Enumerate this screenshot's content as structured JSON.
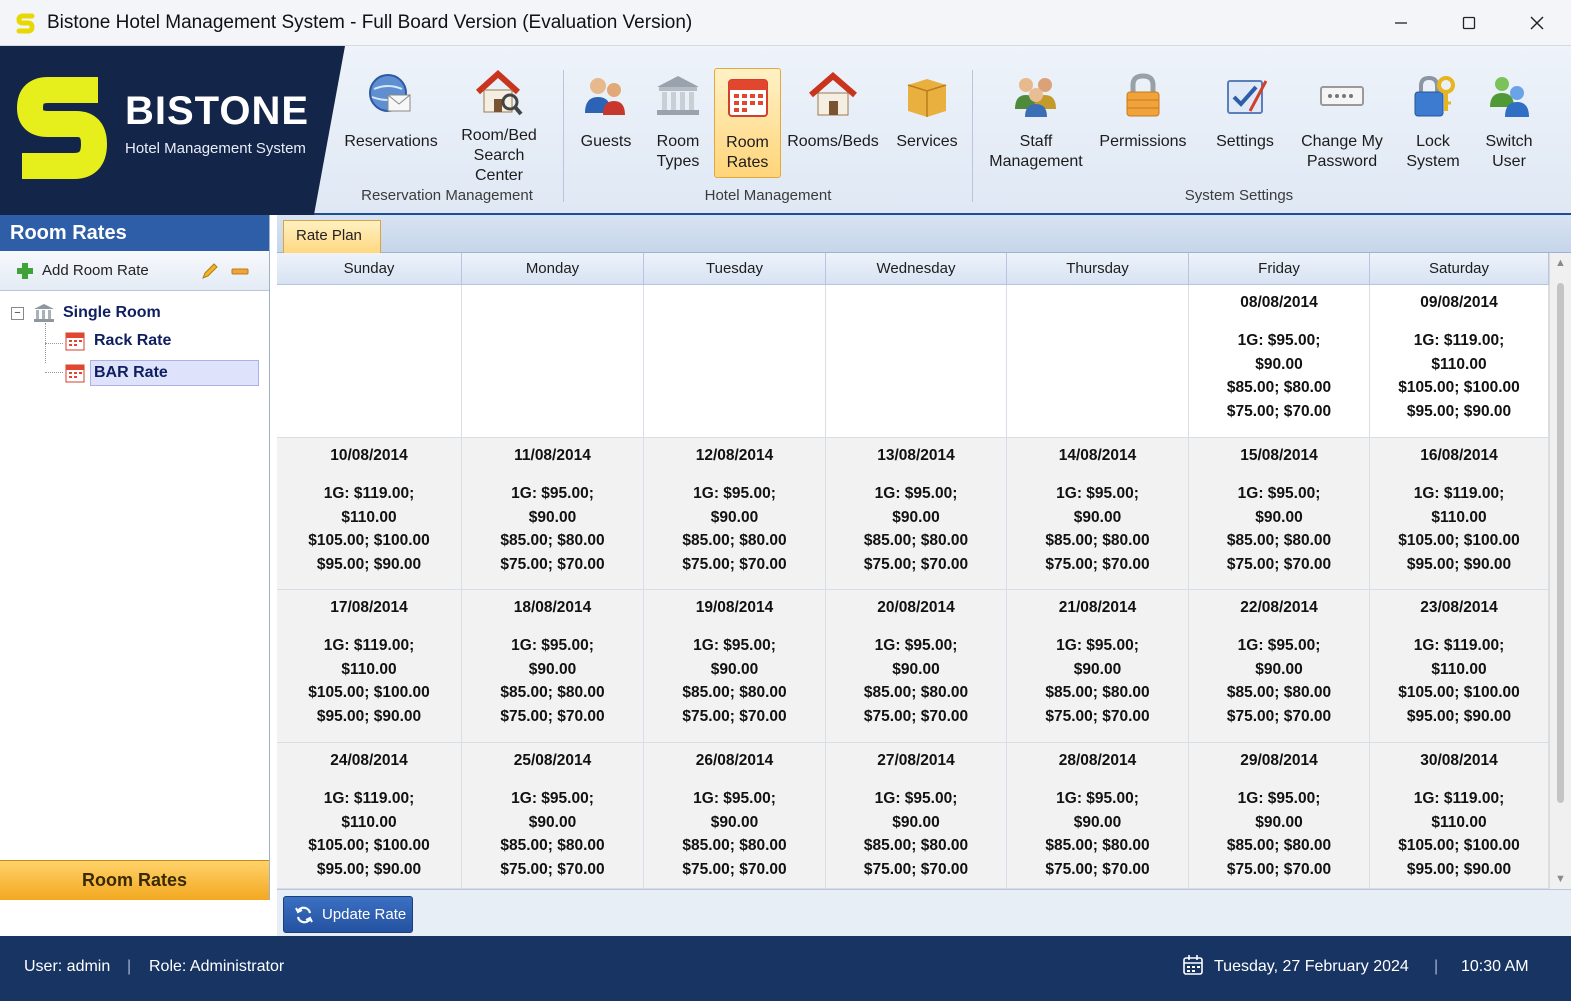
{
  "window": {
    "title": "Bistone Hotel Management System - Full Board Version (Evaluation Version)"
  },
  "logo": {
    "title": "BISTONE",
    "subtitle": "Hotel Management System"
  },
  "ribbon": {
    "groups": [
      {
        "label": "Reservation Management"
      },
      {
        "label": "Hotel Management"
      },
      {
        "label": "System Settings"
      }
    ],
    "buttons": [
      {
        "label": "Reservations",
        "icon": "globe-envelope-icon"
      },
      {
        "label": "Room/Bed\nSearch Center",
        "icon": "house-search-icon"
      },
      {
        "label": "Guests",
        "icon": "guests-icon"
      },
      {
        "label": "Room\nTypes",
        "icon": "building-columns-icon"
      },
      {
        "label": "Room\nRates",
        "icon": "calendar-icon",
        "active": true
      },
      {
        "label": "Rooms/Beds",
        "icon": "house-icon"
      },
      {
        "label": "Services",
        "icon": "box-icon"
      },
      {
        "label": "Staff\nManagement",
        "icon": "staff-icon"
      },
      {
        "label": "Permissions",
        "icon": "padlock-icon"
      },
      {
        "label": "Settings",
        "icon": "settings-icon"
      },
      {
        "label": "Change My\nPassword",
        "icon": "password-field-icon"
      },
      {
        "label": "Lock\nSystem",
        "icon": "lock-key-icon"
      },
      {
        "label": "Switch\nUser",
        "icon": "switch-user-icon"
      }
    ]
  },
  "left_panel": {
    "header": "Room Rates",
    "add_label": "Add Room Rate",
    "tree": {
      "root": "Single Room",
      "children": [
        "Rack Rate",
        "BAR Rate"
      ],
      "selected": "BAR Rate"
    },
    "footer": "Room Rates"
  },
  "main": {
    "tab": "Rate Plan",
    "days": [
      "Sunday",
      "Monday",
      "Tuesday",
      "Wednesday",
      "Thursday",
      "Friday",
      "Saturday"
    ],
    "weeks": [
      [
        null,
        null,
        null,
        null,
        null,
        {
          "date": "08/08/2014",
          "lines": [
            "1G: $95.00;",
            "$90.00",
            "$85.00; $80.00",
            "$75.00; $70.00"
          ]
        },
        {
          "date": "09/08/2014",
          "lines": [
            "1G: $119.00;",
            "$110.00",
            "$105.00; $100.00",
            "$95.00; $90.00"
          ]
        }
      ],
      [
        {
          "date": "10/08/2014",
          "lines": [
            "1G: $119.00;",
            "$110.00",
            "$105.00; $100.00",
            "$95.00; $90.00"
          ]
        },
        {
          "date": "11/08/2014",
          "lines": [
            "1G: $95.00;",
            "$90.00",
            "$85.00; $80.00",
            "$75.00; $70.00"
          ]
        },
        {
          "date": "12/08/2014",
          "lines": [
            "1G: $95.00;",
            "$90.00",
            "$85.00; $80.00",
            "$75.00; $70.00"
          ]
        },
        {
          "date": "13/08/2014",
          "lines": [
            "1G: $95.00;",
            "$90.00",
            "$85.00; $80.00",
            "$75.00; $70.00"
          ]
        },
        {
          "date": "14/08/2014",
          "lines": [
            "1G: $95.00;",
            "$90.00",
            "$85.00; $80.00",
            "$75.00; $70.00"
          ]
        },
        {
          "date": "15/08/2014",
          "lines": [
            "1G: $95.00;",
            "$90.00",
            "$85.00; $80.00",
            "$75.00; $70.00"
          ]
        },
        {
          "date": "16/08/2014",
          "lines": [
            "1G: $119.00;",
            "$110.00",
            "$105.00; $100.00",
            "$95.00; $90.00"
          ]
        }
      ],
      [
        {
          "date": "17/08/2014",
          "lines": [
            "1G: $119.00;",
            "$110.00",
            "$105.00; $100.00",
            "$95.00; $90.00"
          ]
        },
        {
          "date": "18/08/2014",
          "lines": [
            "1G: $95.00;",
            "$90.00",
            "$85.00; $80.00",
            "$75.00; $70.00"
          ]
        },
        {
          "date": "19/08/2014",
          "lines": [
            "1G: $95.00;",
            "$90.00",
            "$85.00; $80.00",
            "$75.00; $70.00"
          ]
        },
        {
          "date": "20/08/2014",
          "lines": [
            "1G: $95.00;",
            "$90.00",
            "$85.00; $80.00",
            "$75.00; $70.00"
          ]
        },
        {
          "date": "21/08/2014",
          "lines": [
            "1G: $95.00;",
            "$90.00",
            "$85.00; $80.00",
            "$75.00; $70.00"
          ]
        },
        {
          "date": "22/08/2014",
          "lines": [
            "1G: $95.00;",
            "$90.00",
            "$85.00; $80.00",
            "$75.00; $70.00"
          ]
        },
        {
          "date": "23/08/2014",
          "lines": [
            "1G: $119.00;",
            "$110.00",
            "$105.00; $100.00",
            "$95.00; $90.00"
          ]
        }
      ],
      [
        {
          "date": "24/08/2014",
          "lines": [
            "1G: $119.00;",
            "$110.00",
            "$105.00; $100.00",
            "$95.00; $90.00"
          ]
        },
        {
          "date": "25/08/2014",
          "lines": [
            "1G: $95.00;",
            "$90.00",
            "$85.00; $80.00",
            "$75.00; $70.00"
          ]
        },
        {
          "date": "26/08/2014",
          "lines": [
            "1G: $95.00;",
            "$90.00",
            "$85.00; $80.00",
            "$75.00; $70.00"
          ]
        },
        {
          "date": "27/08/2014",
          "lines": [
            "1G: $95.00;",
            "$90.00",
            "$85.00; $80.00",
            "$75.00; $70.00"
          ]
        },
        {
          "date": "28/08/2014",
          "lines": [
            "1G: $95.00;",
            "$90.00",
            "$85.00; $80.00",
            "$75.00; $70.00"
          ]
        },
        {
          "date": "29/08/2014",
          "lines": [
            "1G: $95.00;",
            "$90.00",
            "$85.00; $80.00",
            "$75.00; $70.00"
          ]
        },
        {
          "date": "30/08/2014",
          "lines": [
            "1G: $119.00;",
            "$110.00",
            "$105.00; $100.00",
            "$95.00; $90.00"
          ]
        }
      ]
    ],
    "update_button": "Update Rate"
  },
  "status": {
    "user": "User: admin",
    "role": "Role: Administrator",
    "separator": "|",
    "date": "Tuesday, 27 February 2024",
    "time": "10:30 AM"
  },
  "colors": {
    "accent": "#2f5ea8",
    "status_bar": "#183463",
    "logo_panel": "#14254a",
    "logo_yellow": "#e6ee1c",
    "active_orange": "#ffd57a"
  }
}
